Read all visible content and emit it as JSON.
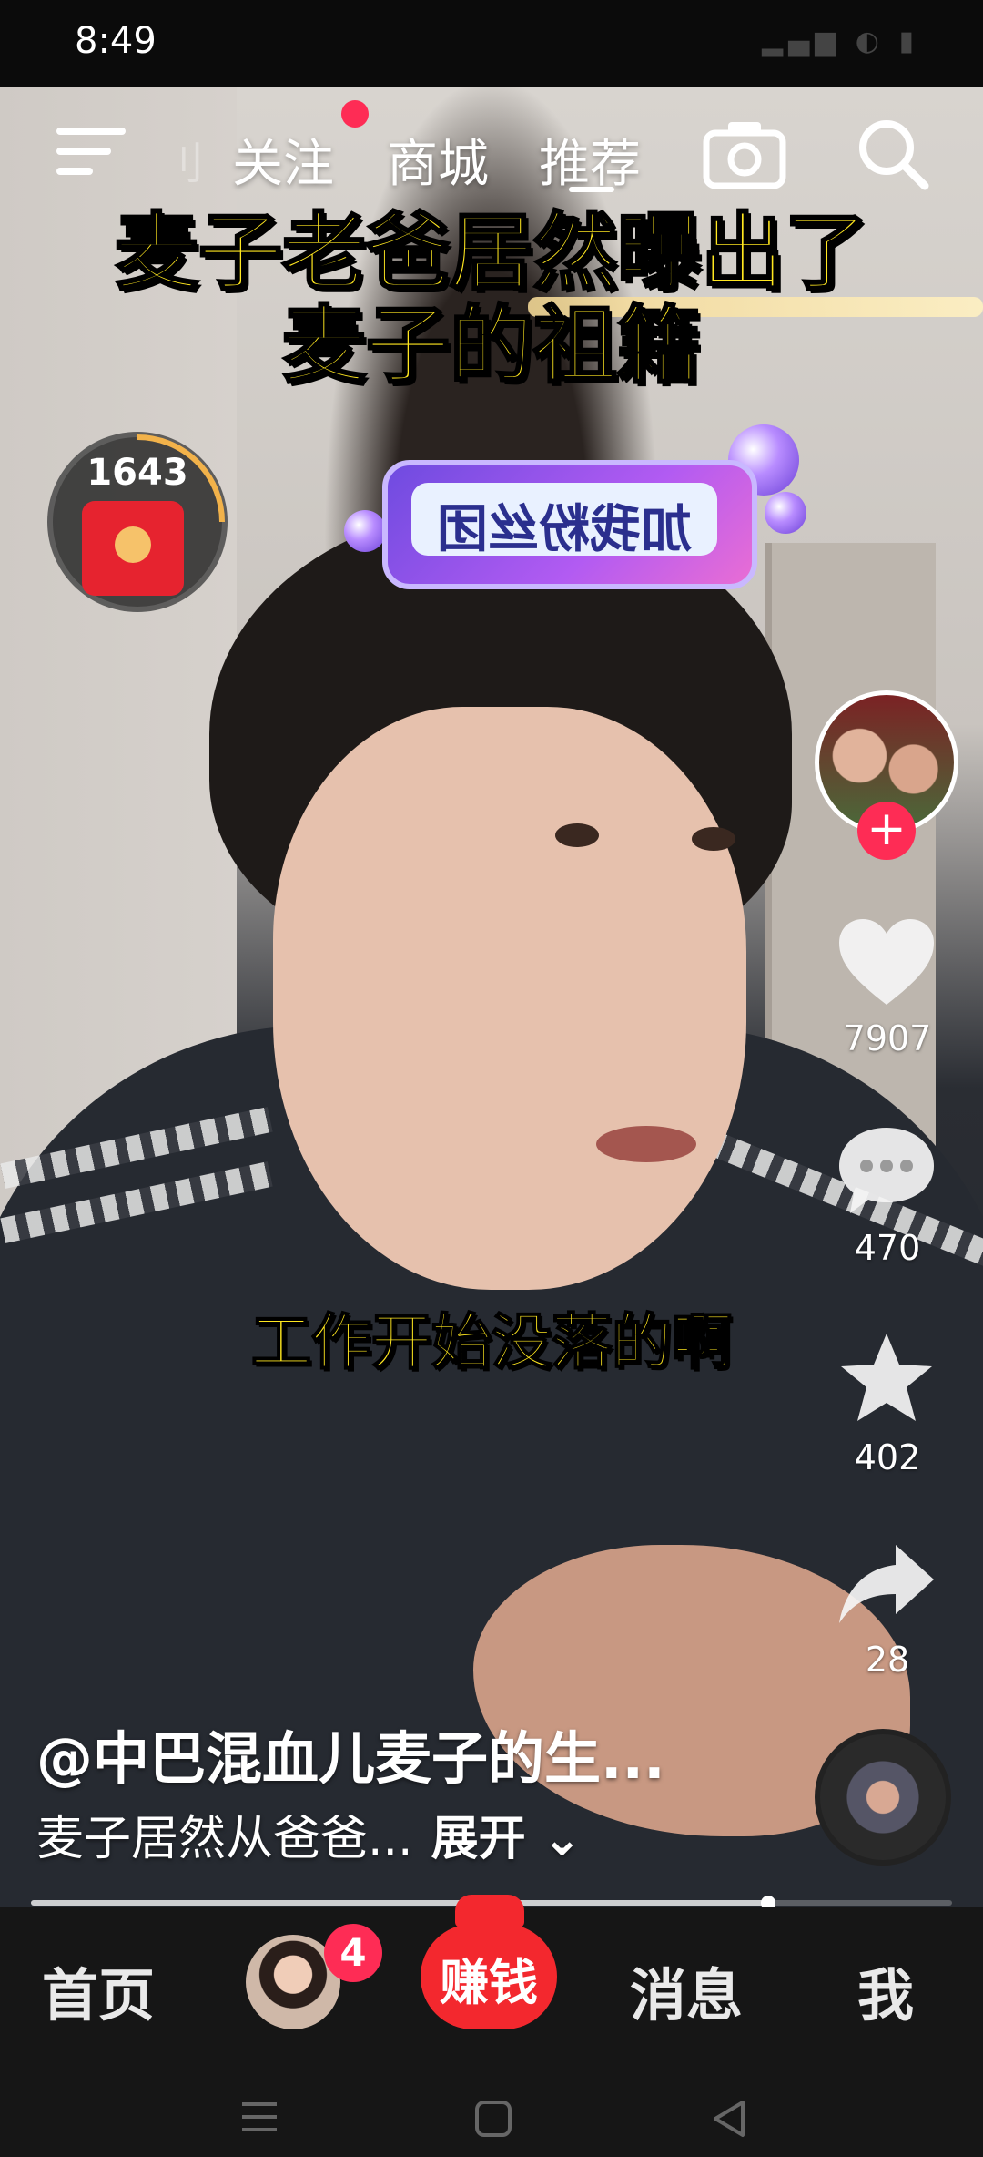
{
  "status_bar": {
    "time": "8:49"
  },
  "top_nav": {
    "faded_tab": "刂",
    "tabs": [
      "关注",
      "商城",
      "推荐"
    ],
    "active_tab": "推荐"
  },
  "video": {
    "headline_line1": "麦子老爸居然曝出了",
    "headline_line2": "麦子的祖籍",
    "sticker_text": "加我粉丝团",
    "subtitle": "工作开始没落的啊"
  },
  "red_packet": {
    "count": "1643"
  },
  "actions": {
    "likes": "7907",
    "comments": "470",
    "favorites": "402",
    "shares": "28"
  },
  "post": {
    "author": "@中巴混血儿麦子的生...",
    "caption": "麦子居然从爸爸...",
    "expand_label": "展开",
    "progress": 0.8
  },
  "bottom_nav": {
    "home": "首页",
    "badge_count": "4",
    "earn": "赚钱",
    "messages": "消息",
    "me": "我"
  },
  "colors": {
    "accent": "#fe2c55",
    "headline": "#ffe71f"
  }
}
